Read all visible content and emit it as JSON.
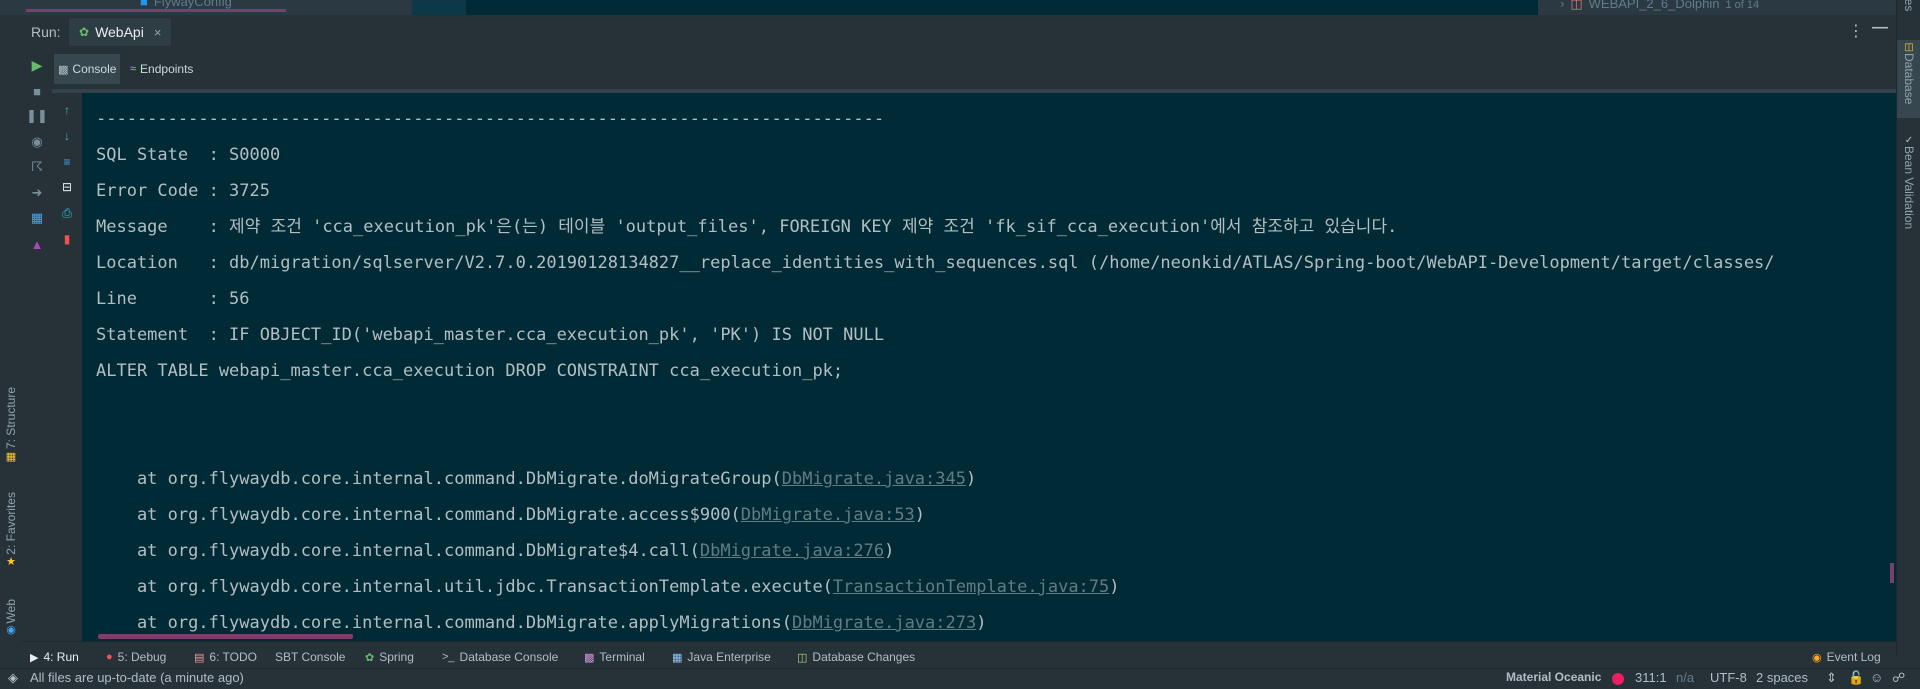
{
  "top_strip": {
    "tab_remnant": "FlywayConfig",
    "db_breadcrumb": "WEBAPI_2_6_Dolphin",
    "db_breadcrumb_count": "1 of 14"
  },
  "run_header": {
    "label": "Run:",
    "tab_name": "WebApi"
  },
  "console_tabs": [
    {
      "label": "Console",
      "active": true
    },
    {
      "label": "Endpoints",
      "active": false
    }
  ],
  "console": {
    "lines": [
      "-----------------------------------------------------------------------------",
      "SQL State  : S0000",
      "Error Code : 3725",
      "Message    : 제약 조건 'cca_execution_pk'은(는) 테이블 'output_files', FOREIGN KEY 제약 조건 'fk_sif_cca_execution'에서 참조하고 있습니다.",
      "Location   : db/migration/sqlserver/V2.7.0.20190128134827__replace_identities_with_sequences.sql (/home/neonkid/ATLAS/Spring-boot/WebAPI-Development/target/classes/",
      "Line       : 56",
      "Statement  : IF OBJECT_ID('webapi_master.cca_execution_pk', 'PK') IS NOT NULL",
      "ALTER TABLE webapi_master.cca_execution DROP CONSTRAINT cca_execution_pk;",
      "",
      ""
    ],
    "stack": [
      {
        "prefix": "    at org.flywaydb.core.internal.command.DbMigrate.doMigrateGroup(",
        "link": "DbMigrate.java:345",
        "suffix": ")"
      },
      {
        "prefix": "    at org.flywaydb.core.internal.command.DbMigrate.access$900(",
        "link": "DbMigrate.java:53",
        "suffix": ")"
      },
      {
        "prefix": "    at org.flywaydb.core.internal.command.DbMigrate$4.call(",
        "link": "DbMigrate.java:276",
        "suffix": ")"
      },
      {
        "prefix": "    at org.flywaydb.core.internal.util.jdbc.TransactionTemplate.execute(",
        "link": "TransactionTemplate.java:75",
        "suffix": ")"
      },
      {
        "prefix": "    at org.flywaydb.core.internal.command.DbMigrate.applyMigrations(",
        "link": "DbMigrate.java:273",
        "suffix": ")"
      }
    ]
  },
  "left_stripe": {
    "structure": "7: Structure",
    "favorites": "2: Favorites",
    "web": "Web"
  },
  "right_stripe": {
    "top_cut": "ges",
    "database": "Database",
    "bean_validation": "Bean Validation"
  },
  "bottom_tabs": [
    {
      "label": "4: Run",
      "active": true
    },
    {
      "label": "5: Debug"
    },
    {
      "label": "6: TODO"
    },
    {
      "label": "SBT Console"
    },
    {
      "label": "Spring"
    },
    {
      "label": "Database Console"
    },
    {
      "label": "Terminal"
    },
    {
      "label": "Java Enterprise"
    },
    {
      "label": "Database Changes"
    },
    {
      "label": "Event Log"
    }
  ],
  "status_bar": {
    "message": "All files are up-to-date (a minute ago)",
    "theme": "Material Oceanic",
    "position": "311:1",
    "na": "n/a",
    "encoding": "UTF-8",
    "indent": "2 spaces"
  }
}
